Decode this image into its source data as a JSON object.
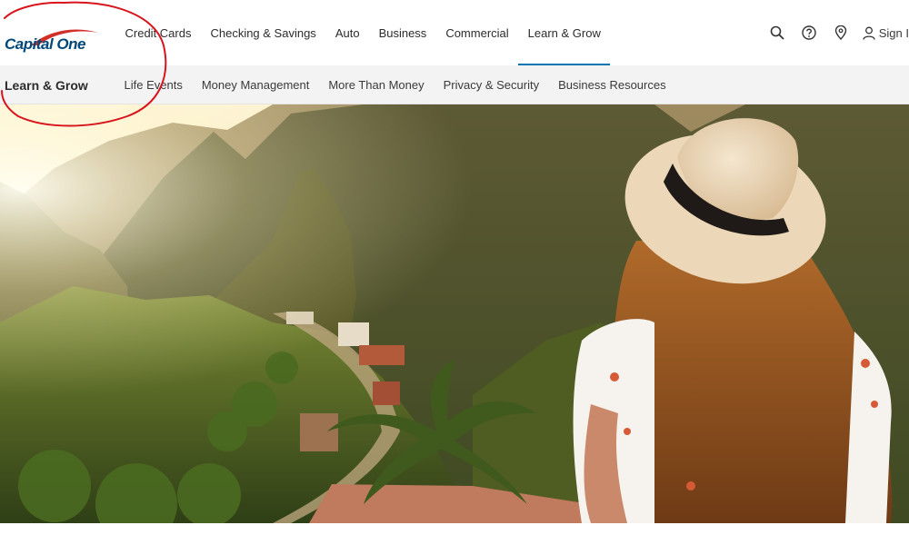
{
  "brand": {
    "logo_text": "Capital One",
    "logo_alt": "Capital One logo",
    "primary_color": "#004879",
    "accent_red": "#d03027"
  },
  "main_nav": [
    {
      "label": "Credit Cards"
    },
    {
      "label": "Checking & Savings"
    },
    {
      "label": "Auto"
    },
    {
      "label": "Business"
    },
    {
      "label": "Commercial"
    },
    {
      "label": "Learn & Grow",
      "active": true
    }
  ],
  "utilities": {
    "search_icon": "search-icon",
    "help_icon": "help-icon",
    "location_icon": "location-pin-icon",
    "signin_label": "Sign I"
  },
  "sub_nav": {
    "section_title": "Learn & Grow",
    "items": [
      {
        "label": "Life Events"
      },
      {
        "label": "Money Management"
      },
      {
        "label": "More Than Money"
      },
      {
        "label": "Privacy & Security"
      },
      {
        "label": "Business Resources"
      }
    ]
  },
  "hero": {
    "image_alt": "Woman in straw hat overlooking a mountain valley village",
    "active_underline_color": "#0276b1"
  },
  "annotation": {
    "color": "#d8141c",
    "shape": "hand-drawn circle around logo"
  }
}
